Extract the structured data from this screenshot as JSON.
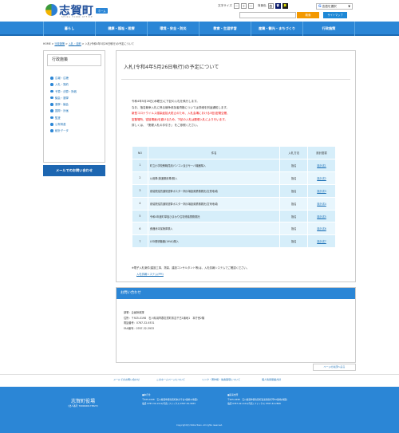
{
  "header": {
    "logo_text": "志賀町",
    "logo_sub": "SHIKA TOWN OFFICE",
    "home_badge": "ホーム",
    "font_size_label": "文字サイズ",
    "font_sizes": [
      "－",
      "＋",
      "一"
    ],
    "colors_label": "背景色",
    "colors": [
      "白",
      "青",
      "黄"
    ],
    "translate_label": "言語を選択",
    "search_button": "検索",
    "sitemap_button": "サイトマップ"
  },
  "nav": [
    "暮らし",
    "健康・福祉・医療",
    "環境・安全・防災",
    "教育・生涯学習",
    "産業・観光・まちづくり",
    "行政施策"
  ],
  "breadcrumb": {
    "items": [
      "HOME",
      "行政施策",
      "入札・契約",
      "入札(令和4年5月26日執行)の予定について"
    ],
    "sep": " > "
  },
  "sidebar": {
    "title": "行政施策",
    "items": [
      "広報・広聴",
      "入札・契約",
      "予算・決算・財政",
      "議会・選挙",
      "選挙・議会",
      "国際・計画",
      "監査",
      "公有財産",
      "統計データ"
    ]
  },
  "mail_button": "メールでのお問い合わせ",
  "main": {
    "title": "入札(令和4年5月26日執行)の予定について",
    "lines": [
      "令和4年5月26日(木曜日)に下記の入札を執行します。",
      "なお、指名競争入札に係る競争参加者資格については詳細を別途通知します。",
      "新型コロナウイルス感染症拡大防止のため、入札会場における3密(密閉空間、",
      "密集場所、密接場面)を避けるため、下記の入札は郵便入札により行います。",
      "詳しくは、「郵便入札の手引き」 をご参照ください。"
    ],
    "guide_link": "郵便入札の手引き",
    "table": {
      "headers": [
        "NO",
        "件名",
        "入札方法",
        "設計図書"
      ],
      "rows": [
        [
          "1",
          "町立小学校教職員用パソコン及びサーバ機器購入",
          "指名",
          "設計書1"
        ],
        [
          "2",
          "公用車(普通乗用車)購入",
          "指名",
          "設計書2"
        ],
        [
          "3",
          "参議院議員通常選挙ポスター掲示場設置業務委託(志賀地域)",
          "指名",
          "設計書3"
        ],
        [
          "4",
          "参議院議員通常選挙ポスター掲示場設置業務委託(富来地域)",
          "指名",
          "設計書4"
        ],
        [
          "5",
          "令和4年度町単独ひまわり住宅修繕業務委託",
          "指名",
          "設計書5"
        ],
        [
          "6",
          "食器消毒保管庫購入",
          "指名",
          "設計書6"
        ],
        [
          "7",
          "LED照明機器(19VA)購入",
          "指名",
          "設計書7"
        ]
      ]
    },
    "note": "※電子入札案件(建設工事、測量、建設コンサルタント等)は、入札情報システムでご確認ください。",
    "note_link": "入札情報システム(PPI)"
  },
  "contact": {
    "title": "お問い合わせ",
    "lines": [
      "部署：企画財政課",
      "住所：〒925-0198　石川県羽咋郡志賀町末吉千古1番地1　本庁舎2階",
      "電話番号：0767-32-9331",
      "FAX番号：0767-32-3933"
    ]
  },
  "pagetop": "ページの先頭へ戻る",
  "footer_links": [
    "メールでのお問い合わせ",
    "このホームページについて",
    "リンク・著作権・免責事項について",
    "個人情報保護方針"
  ],
  "footer": {
    "name": "志賀町役場",
    "code": "(法人番号 7000020173823)",
    "col1": [
      "■本庁舎",
      "〒925-0198　石川県羽咋郡志賀町末吉千古1番地1(地図)",
      "電話 0767-32-1111(代表)  ファックス 0767-32-3933"
    ],
    "col2": [
      "■富来支所",
      "〒925-0498　石川県羽咋郡志賀町富来領家町甲10番地(地図)",
      "電話 0767-42-1111(代表)  ファックス 0767-42-2826"
    ],
    "copyright": "Copyright(C) Shika Town. All rights reserved."
  },
  "colors": {
    "accent": "#2b86d6",
    "nav_dark": "#1c6bb4",
    "search": "#f39800",
    "table_bg": "#d6eefa",
    "red_text": "#ee0000"
  }
}
